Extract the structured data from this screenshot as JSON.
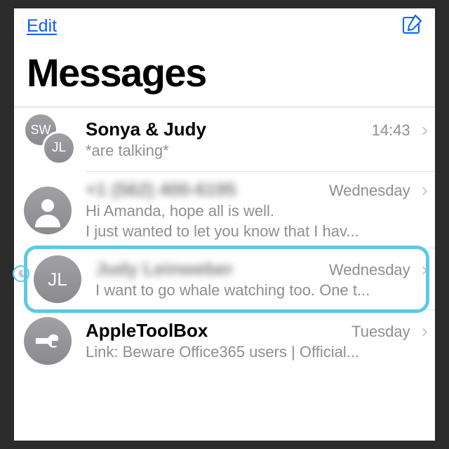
{
  "nav": {
    "edit": "Edit",
    "compose": "compose"
  },
  "title": "Messages",
  "rows": [
    {
      "name": "Sonya & Judy",
      "time": "14:43",
      "preview": "*are talking*",
      "av1": "SW",
      "av2": "JL"
    },
    {
      "name": "+1 (562) 400-6195",
      "time": "Wednesday",
      "preview": "Hi Amanda, hope all is well.\nI just wanted to let you know that I hav..."
    },
    {
      "name": "Judy Leinweber",
      "time": "Wednesday",
      "preview": "I want to go whale watching too. One t...",
      "initials": "JL"
    },
    {
      "name": "AppleToolBox",
      "time": "Tuesday",
      "preview": "Link: Beware Office365 users | Official..."
    }
  ]
}
